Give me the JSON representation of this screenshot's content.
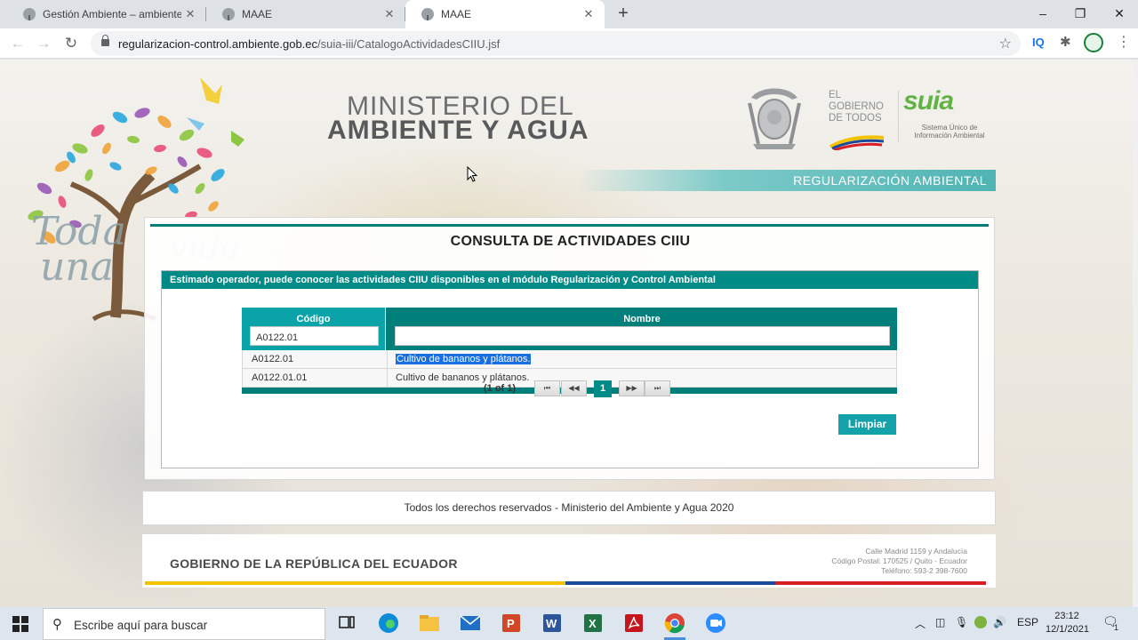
{
  "browser": {
    "tabs": [
      {
        "title": "Gestión Ambiente – ambiente-ag",
        "active": false
      },
      {
        "title": "MAAE",
        "active": false
      },
      {
        "title": "MAAE",
        "active": true
      }
    ],
    "close_glyph": "✕",
    "new_tab_glyph": "+",
    "window_controls": [
      "–",
      "❐",
      "✕"
    ],
    "url_host": "regularizacion-control.ambiente.gob.ec",
    "url_path": "/suia-iii/CatalogoActividadesCIIU.jsf",
    "extension_iq": "IQ"
  },
  "header": {
    "ministry_line1": "MINISTERIO DEL",
    "ministry_line2": "AMBIENTE Y AGUA",
    "gobierno_lines": [
      "EL",
      "GOBIERNO",
      "DE TODOS"
    ],
    "suia_logo": "suia",
    "suia_subtitle": "Sistema Único de Información Ambiental",
    "section_banner": "REGULARIZACIÓN AMBIENTAL",
    "tree_logo_text": [
      "Toda",
      "una",
      "vida"
    ]
  },
  "main": {
    "title": "CONSULTA DE ACTIVIDADES CIIU",
    "info_message": "Estimado operador, puede conocer las actividades CIIU disponibles en el módulo Regularización y Control Ambiental",
    "columns": {
      "codigo": "Código",
      "nombre": "Nombre"
    },
    "filters": {
      "codigo": "A0122.01",
      "nombre": ""
    },
    "rows": [
      {
        "codigo": "A0122.01",
        "nombre": "Cultivo de bananos y plátanos.",
        "selected_text": true
      },
      {
        "codigo": "A0122.01.01",
        "nombre": "Cultivo de bananos y plátanos.",
        "selected_text": false
      }
    ],
    "paginator": {
      "current_report": "(1 of 1)",
      "current_page": "1",
      "first": "⏮",
      "prev": "◀◀",
      "next": "▶▶",
      "last": "⏭"
    },
    "clear_button": "Limpiar"
  },
  "footer": {
    "copyright": "Todos los derechos reservados - Ministerio del Ambiente y Agua 2020",
    "government": "GOBIERNO DE LA REPÚBLICA DEL ECUADOR",
    "address_lines": [
      "Calle Madrid 1159 y Andalucía",
      "Código Postal: 170525 / Quito - Ecuador",
      "Teléfono: 593-2 398-7600"
    ],
    "flag_colors": [
      "#f4c300",
      "#1c4b9b",
      "#d91f26"
    ]
  },
  "taskbar": {
    "search_placeholder": "Escribe aquí para buscar",
    "apps": [
      "task-view-icon",
      "edge-icon",
      "file-explorer-icon",
      "mail-icon",
      "powerpoint-icon",
      "word-icon",
      "excel-icon",
      "acrobat-icon",
      "chrome-icon",
      "zoom-icon"
    ],
    "language": "ESP",
    "time": "23:12",
    "date": "12/1/2021",
    "notification_count": "1"
  },
  "colors": {
    "teal_primary": "#008b87",
    "teal_light": "#14a2aa",
    "selection": "#1a6fe0"
  }
}
